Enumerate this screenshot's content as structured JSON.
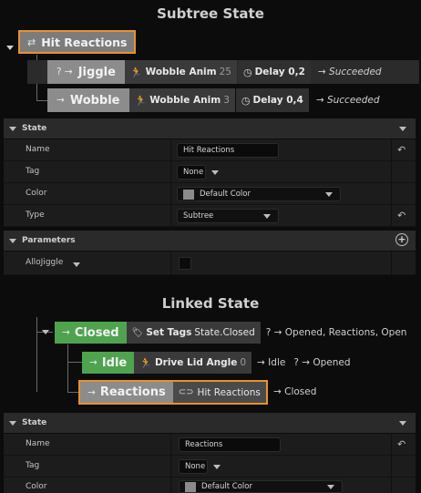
{
  "subtree_section": {
    "title": "Subtree State",
    "root": {
      "icon": "shuffle-icon",
      "label": "Hit Reactions"
    },
    "children": [
      {
        "prefix": "? →",
        "label": "Jiggle",
        "task": "Wobble Anim",
        "task_value": "25",
        "delay": "Delay 0,2",
        "result": "→ Succeeded"
      },
      {
        "prefix": "→",
        "label": "Wobble",
        "task": "Wobble Anim",
        "task_value": "3",
        "delay": "Delay 0,4",
        "result": "→ Succeeded"
      }
    ]
  },
  "state_panel_1": {
    "header": "State",
    "rows": [
      {
        "label": "Name",
        "value": "Hit Reactions"
      },
      {
        "label": "Tag",
        "value": "None"
      },
      {
        "label": "Color",
        "value": "Default Color",
        "swatch": "#8a8a8a"
      },
      {
        "label": "Type",
        "value": "Subtree"
      }
    ]
  },
  "parameters_panel": {
    "header": "Parameters",
    "rows": [
      {
        "label": "AlloJiggle"
      }
    ]
  },
  "linked_section": {
    "title": "Linked State",
    "closed": {
      "label": "Closed",
      "action": "Set Tags",
      "action_value": "State.Closed",
      "transitions": "? → Opened, Reactions, Open"
    },
    "idle": {
      "label": "Idle",
      "action": "Drive Lid Angle",
      "action_value": "0",
      "t1": "→ Idle",
      "t2": "? → Opened"
    },
    "reactions": {
      "label": "Reactions",
      "link": "Hit Reactions",
      "transition": "→ Closed"
    }
  },
  "state_panel_2": {
    "header": "State",
    "rows": [
      {
        "label": "Name",
        "value": "Reactions"
      },
      {
        "label": "Tag",
        "value": "None"
      },
      {
        "label": "Color",
        "value": "Default Color",
        "swatch": "#8a8a8a"
      }
    ]
  },
  "colors": {
    "accent": "#e8922a",
    "gray_node": "#8c8c8c",
    "green_node": "#4fa34f"
  }
}
